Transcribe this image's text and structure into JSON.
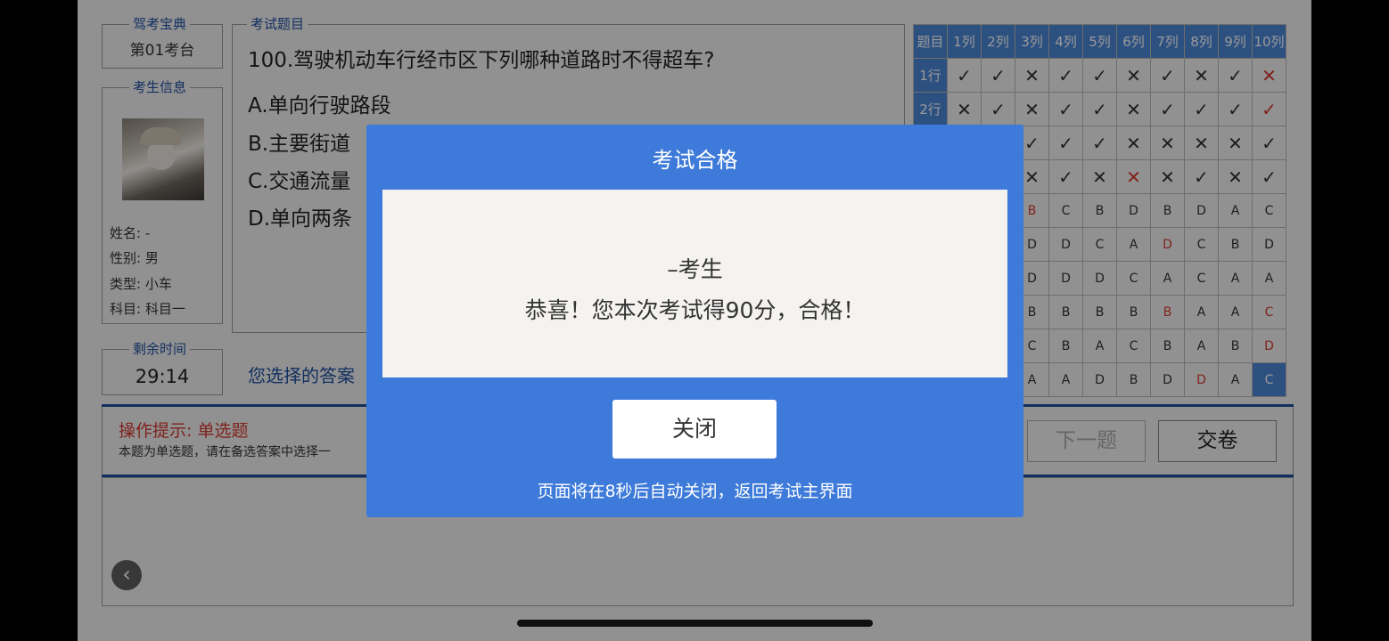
{
  "app": {
    "brand_legend": "驾考宝典",
    "station": "第01考台",
    "question_legend": "考试题目",
    "examinee_legend": "考生信息",
    "timer_legend": "剩余时间",
    "timer_value": "29:14"
  },
  "question": {
    "title": "100.驾驶机动车行经市区下列哪种道路时不得超车?",
    "options": [
      "A.单向行驶路段",
      "B.主要街道",
      "C.交通流量",
      "D.单向两条"
    ],
    "selected_label": "您选择的答案"
  },
  "examinee": {
    "name": "姓名: -",
    "gender": "性别: 男",
    "type": "类型: 小车",
    "subject": "科目: 科目一"
  },
  "hint": {
    "title": "操作提示: 单选题",
    "text": "本题为单选题，请在备选答案中选择一"
  },
  "buttons": {
    "next": "下一题",
    "submit": "交卷"
  },
  "grid": {
    "corner": "题目",
    "columns": [
      "1列",
      "2列",
      "3列",
      "4列",
      "5列",
      "6列",
      "7列",
      "8列",
      "9列",
      "10列"
    ],
    "rows": [
      {
        "label": "1行",
        "cells": [
          "✓",
          "✓",
          "✕",
          "✓",
          "✓",
          "✕",
          "✓",
          "✕",
          "✓",
          "✕"
        ],
        "red": [
          9
        ]
      },
      {
        "label": "2行",
        "cells": [
          "✕",
          "✓",
          "✕",
          "✓",
          "✓",
          "✕",
          "✓",
          "✓",
          "✓",
          "✓"
        ],
        "red": [
          9
        ]
      },
      {
        "label": "",
        "cells": [
          "",
          "",
          "✓",
          "✓",
          "✓",
          "✕",
          "✕",
          "✕",
          "✕",
          "✓"
        ],
        "red": []
      },
      {
        "label": "",
        "cells": [
          "",
          "",
          "✕",
          "✓",
          "✕",
          "✕",
          "✕",
          "✓",
          "✕",
          "✓"
        ],
        "red": [
          5
        ]
      },
      {
        "label": "",
        "cells": [
          "",
          "",
          "B",
          "C",
          "B",
          "D",
          "B",
          "D",
          "A",
          "C"
        ],
        "red": [
          2
        ]
      },
      {
        "label": "",
        "cells": [
          "",
          "",
          "D",
          "D",
          "C",
          "A",
          "D",
          "C",
          "B",
          "D"
        ],
        "red": [
          6
        ]
      },
      {
        "label": "",
        "cells": [
          "",
          "",
          "D",
          "D",
          "D",
          "C",
          "A",
          "C",
          "A",
          "A"
        ],
        "red": []
      },
      {
        "label": "",
        "cells": [
          "",
          "",
          "B",
          "B",
          "B",
          "B",
          "B",
          "A",
          "A",
          "C"
        ],
        "red": [
          6,
          9
        ]
      },
      {
        "label": "",
        "cells": [
          "",
          "",
          "C",
          "B",
          "A",
          "C",
          "B",
          "A",
          "B",
          "D"
        ],
        "red": [
          9
        ]
      },
      {
        "label": "",
        "cells": [
          "",
          "",
          "A",
          "A",
          "D",
          "B",
          "D",
          "D",
          "A",
          "C"
        ],
        "red": [
          7
        ],
        "current": 9
      }
    ]
  },
  "modal": {
    "title": "考试合格",
    "line1": "–考生",
    "line2": "恭喜！您本次考试得90分，合格！",
    "close": "关闭",
    "footer": "页面将在8秒后自动关闭，返回考试主界面"
  },
  "icons": {
    "back": "chevron-left-icon"
  },
  "colors": {
    "accent": "#3d7ad9",
    "grid_header": "#4a86d6",
    "error_red": "#d43a2f"
  }
}
